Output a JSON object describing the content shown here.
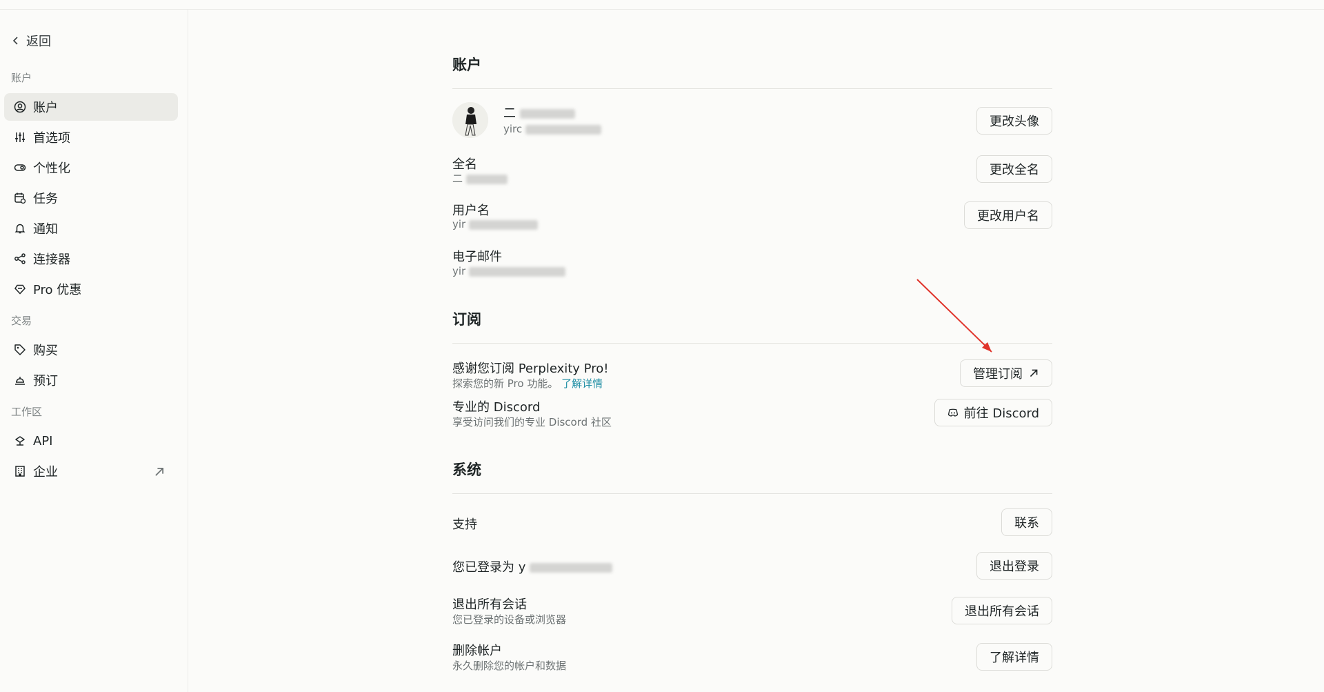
{
  "sidebar": {
    "back_label": "返回",
    "sections": {
      "account": "账户",
      "trade": "交易",
      "workspace": "工作区"
    },
    "items": [
      {
        "label": "账户",
        "icon": "user-circle-icon",
        "active": true
      },
      {
        "label": "首选项",
        "icon": "sliders-icon"
      },
      {
        "label": "个性化",
        "icon": "toggle-icon"
      },
      {
        "label": "任务",
        "icon": "calendar-clock-icon"
      },
      {
        "label": "通知",
        "icon": "bell-icon"
      },
      {
        "label": "连接器",
        "icon": "connector-icon"
      },
      {
        "label": "Pro 优惠",
        "icon": "gem-icon"
      },
      {
        "label": "购买",
        "icon": "tag-icon"
      },
      {
        "label": "预订",
        "icon": "booking-icon"
      },
      {
        "label": "API",
        "icon": "api-icon"
      },
      {
        "label": "企业",
        "icon": "building-icon"
      }
    ]
  },
  "account": {
    "title": "账户",
    "profile_name_prefix": "二",
    "profile_handle_prefix": "yirc",
    "change_avatar": "更改头像",
    "fullname_label": "全名",
    "fullname_value_prefix": "二",
    "change_fullname": "更改全名",
    "username_label": "用户名",
    "username_value_prefix": "yir",
    "change_username": "更改用户名",
    "email_label": "电子邮件",
    "email_value_prefix": "yir"
  },
  "subscription": {
    "title": "订阅",
    "thanks": "感谢您订阅 Perplexity Pro!",
    "explore": "探索您的新 Pro 功能。",
    "learn_more": "了解详情",
    "manage": "管理订阅",
    "discord_title": "专业的 Discord",
    "discord_sub": "享受访问我们的专业 Discord 社区",
    "discord_button": "前往 Discord"
  },
  "system": {
    "title": "系统",
    "support": "支持",
    "contact": "联系",
    "logged_in_as": "您已登录为 y",
    "logout": "退出登录",
    "logout_all_title": "退出所有会话",
    "logout_all_sub": "您已登录的设备或浏览器",
    "logout_all_button": "退出所有会话",
    "delete_title": "删除帐户",
    "delete_sub": "永久删除您的帐户和数据",
    "delete_button": "了解详情"
  },
  "colors": {
    "accent_link": "#1f8ea4",
    "annotation_arrow": "#e0342b"
  }
}
